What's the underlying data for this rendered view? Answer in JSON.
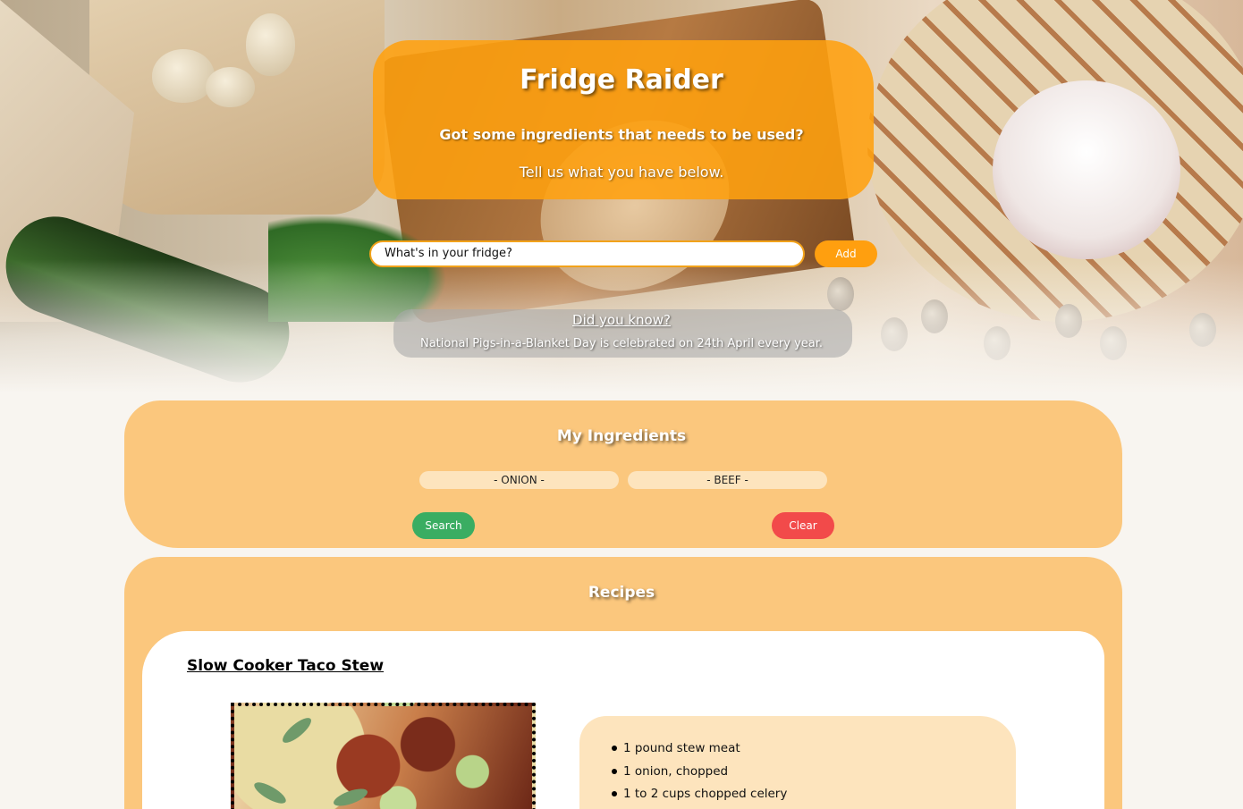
{
  "hero": {
    "title": "Fridge Raider",
    "subtitle": "Got some ingredients that needs to be used?",
    "prompt": "Tell us what you have below.",
    "input_placeholder": "What's in your fridge?",
    "add_label": "Add"
  },
  "fact": {
    "title": "Did you know?",
    "text": "National Pigs-in-a-Blanket Day is celebrated on 24th April every year."
  },
  "ingredients": {
    "title": "My Ingredients",
    "items": [
      "- ONION -",
      "- BEEF -"
    ],
    "search_label": "Search",
    "clear_label": "Clear"
  },
  "recipes": {
    "title": "Recipes",
    "items": [
      {
        "title": "Slow Cooker Taco Stew",
        "ingredients": [
          "1 pound stew meat",
          "1 onion, chopped",
          "1 to 2 cups chopped celery"
        ]
      }
    ]
  },
  "colors": {
    "accent": "#ff9f0f",
    "panel": "#fbc77d",
    "search": "#3aad62",
    "clear": "#f24a4a"
  }
}
